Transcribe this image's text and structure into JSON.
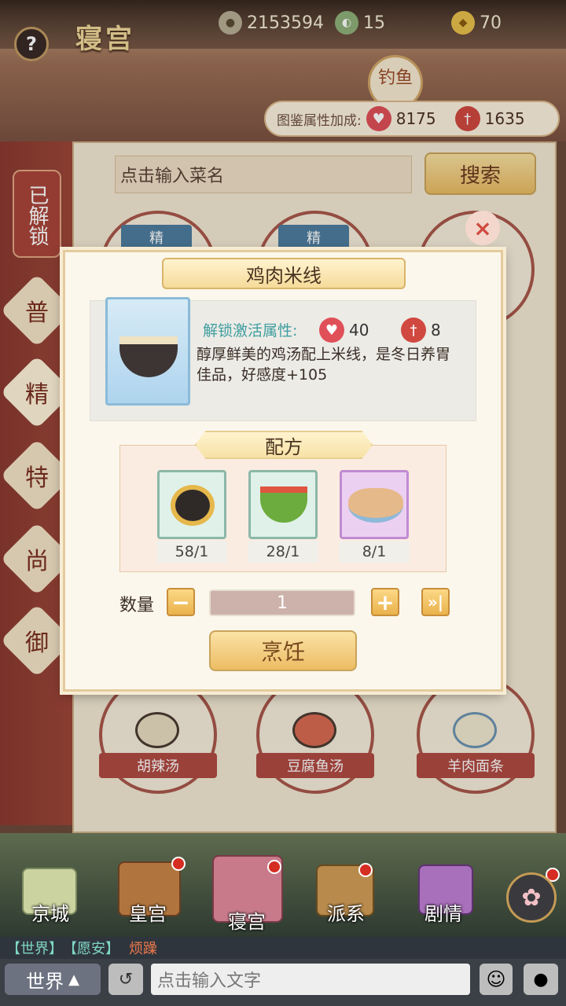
{
  "header": {
    "title": "寝宫",
    "help_label": "?"
  },
  "currencies": [
    {
      "icon": "coin-icon",
      "value": "2153594"
    },
    {
      "icon": "gourd-icon",
      "value": "15"
    },
    {
      "icon": "gold-ingot-icon",
      "value": "70"
    }
  ],
  "fish_button": "钓鱼",
  "codex_bonus": {
    "label": "图鉴属性加成:",
    "heart_value": "8175",
    "knife_value": "1635"
  },
  "sidebar": {
    "unlocked_label": "已解锁",
    "tabs": [
      "普",
      "精",
      "特",
      "尚",
      "御"
    ]
  },
  "search": {
    "placeholder": "点击输入菜名",
    "button_label": "搜索"
  },
  "dish_tags": [
    "精",
    "精"
  ],
  "dishes_bottom": [
    "胡辣汤",
    "豆腐鱼汤",
    "羊肉面条"
  ],
  "modal": {
    "title": "鸡肉米线",
    "close_label": "×",
    "unlock_label": "解锁激活属性:",
    "heart_value": "40",
    "knife_value": "8",
    "description": "醇厚鲜美的鸡汤配上米线，是冬日养胃佳品，好感度+105",
    "recipe_label": "配方",
    "ingredients": [
      {
        "icon": "noodles-icon",
        "count": "58/1"
      },
      {
        "icon": "vegetables-icon",
        "count": "28/1"
      },
      {
        "icon": "chicken-icon",
        "count": "8/1"
      }
    ],
    "quantity_label": "数量",
    "quantity_value": "1",
    "cook_label": "烹饪"
  },
  "bottom_nav": [
    "京城",
    "皇宫",
    "寝宫",
    "派系",
    "剧情"
  ],
  "chat": {
    "channel": "【世界】",
    "user": "【愿安】",
    "message": "烦躁",
    "world_label": "世界",
    "input_placeholder": "点击输入文字"
  },
  "colors": {
    "accent_red": "#b04a42",
    "gold": "#e8bb62",
    "teal_text": "#3f9ea0"
  }
}
